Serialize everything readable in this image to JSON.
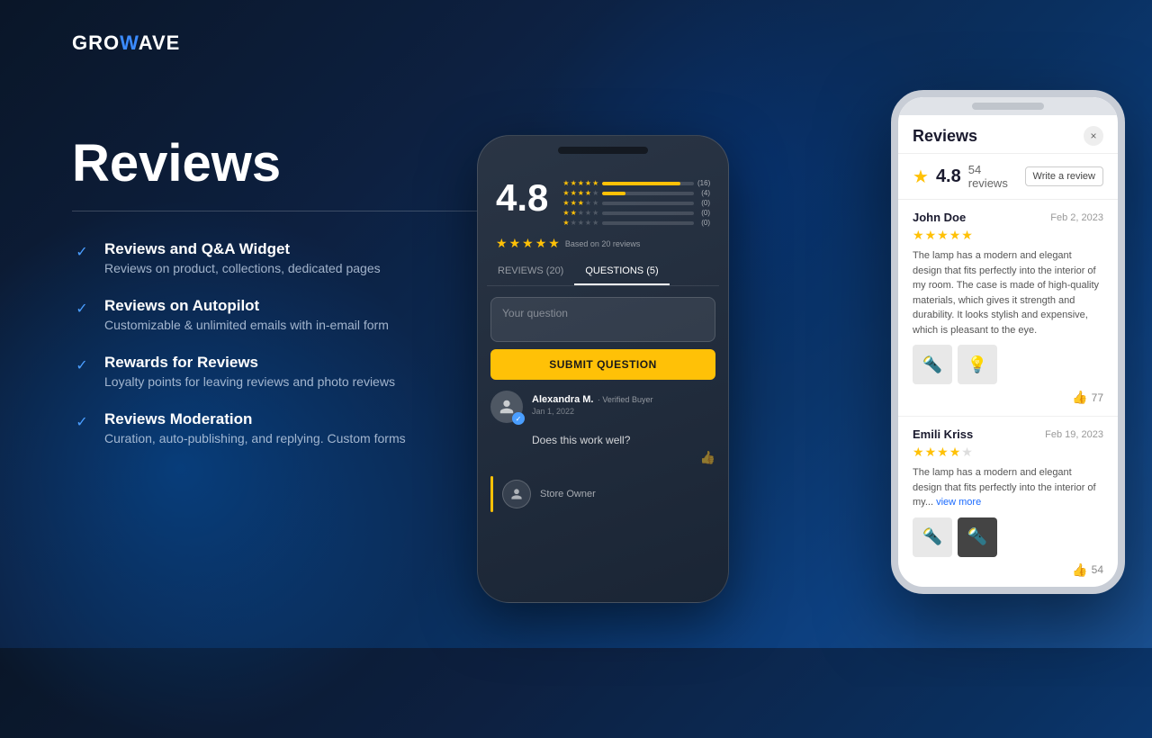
{
  "logo": {
    "text_before": "GRO",
    "wave": "W",
    "text_after": "AVE"
  },
  "heading": {
    "title": "Reviews"
  },
  "features": [
    {
      "id": "qa-widget",
      "title": "Reviews and Q&A Widget",
      "desc": "Reviews on product, collections, dedicated pages"
    },
    {
      "id": "autopilot",
      "title": "Reviews on Autopilot",
      "desc": "Customizable & unlimited emails with in-email form"
    },
    {
      "id": "rewards",
      "title": "Rewards for Reviews",
      "desc": "Loyalty points for leaving reviews and photo reviews"
    },
    {
      "id": "moderation",
      "title": "Reviews Moderation",
      "desc": "Curation, auto-publishing, and replying. Custom forms"
    }
  ],
  "dark_phone": {
    "rating": "4.8",
    "based_on": "Based on 20 reviews",
    "star_rows": [
      {
        "stars": 5,
        "count": "(16)",
        "width": 85
      },
      {
        "stars": 4,
        "count": "(4)",
        "width": 25
      },
      {
        "stars": 3,
        "count": "(0)",
        "width": 0
      },
      {
        "stars": 2,
        "count": "(0)",
        "width": 0
      },
      {
        "stars": 1,
        "count": "(0)",
        "width": 0
      }
    ],
    "tabs": [
      {
        "label": "REVIEWS (20)",
        "active": false
      },
      {
        "label": "QUESTIONS (5)",
        "active": true
      }
    ],
    "question_placeholder": "Your question",
    "submit_label": "SUBMIT QUESTION",
    "reviewer": {
      "name": "Alexandra M.",
      "badge": "· Verified Buyer",
      "date": "Jan 1, 2022"
    },
    "review_question": "Does this work well?",
    "store_owner_label": "Store Owner"
  },
  "light_phone": {
    "title": "Reviews",
    "close": "×",
    "rating": "4.8",
    "reviews_count": "54 reviews",
    "write_review": "Write a review",
    "reviews": [
      {
        "name": "John Doe",
        "date": "Feb 2, 2023",
        "stars": 5,
        "text": "The lamp has a modern and elegant design that fits perfectly into the interior of my room. The case is made of high-quality materials, which gives it strength and durability. It looks stylish and expensive, which is pleasant to the eye.",
        "likes": 77,
        "has_images": true
      },
      {
        "name": "Emili Kriss",
        "date": "Feb 19, 2023",
        "stars": 3.5,
        "text": "The lamp has a modern and elegant design that fits perfectly into the interior of my...",
        "view_more": "view more",
        "likes": 54,
        "has_images": true
      }
    ]
  }
}
